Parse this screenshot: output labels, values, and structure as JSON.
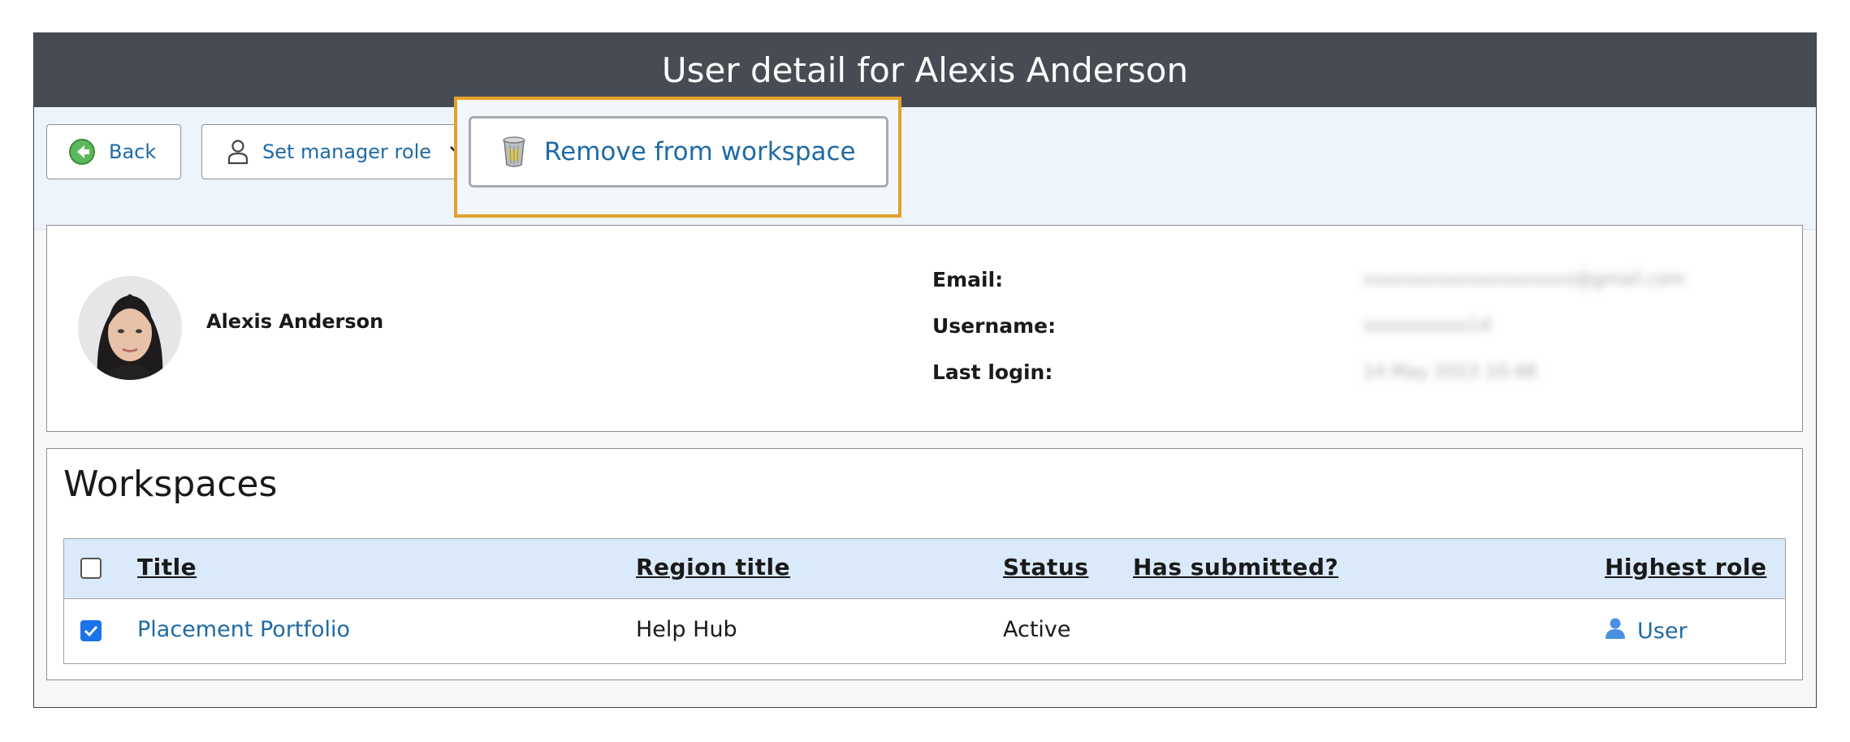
{
  "window": {
    "title": "User detail for Alexis Anderson"
  },
  "toolbar": {
    "back_label": "Back",
    "manager_role_label": "Set manager role",
    "remove_label": "Remove from workspace"
  },
  "icons": {
    "back": "back-arrow-icon",
    "manager": "person-outline-icon",
    "dropdown": "chevron-down-icon",
    "remove": "trash-can-icon",
    "role": "user-person-icon"
  },
  "profile": {
    "name": "Alexis Anderson",
    "email_label": "Email:",
    "username_label": "Username:",
    "last_login_label": "Last login:",
    "email_value": "xxxxxxxxxxxxxxxxxxxx@gmail.com",
    "username_value": "xxxxxxxxxx14",
    "last_login_value": "14 May 2023 10:48"
  },
  "workspaces": {
    "heading": "Workspaces",
    "columns": {
      "title": "Title",
      "region": "Region title",
      "status": "Status",
      "submitted": "Has submitted?",
      "role": "Highest role"
    },
    "rows": [
      {
        "checked": true,
        "title": "Placement Portfolio",
        "region": "Help Hub",
        "status": "Active",
        "submitted": "",
        "role": "User"
      }
    ]
  },
  "colors": {
    "titlebar": "#474c54",
    "toolbar": "#edf4fb",
    "link": "#1f6aa5",
    "highlight": "#e3a12c",
    "table_header": "#dbeafa",
    "checkbox": "#1a73e8"
  }
}
